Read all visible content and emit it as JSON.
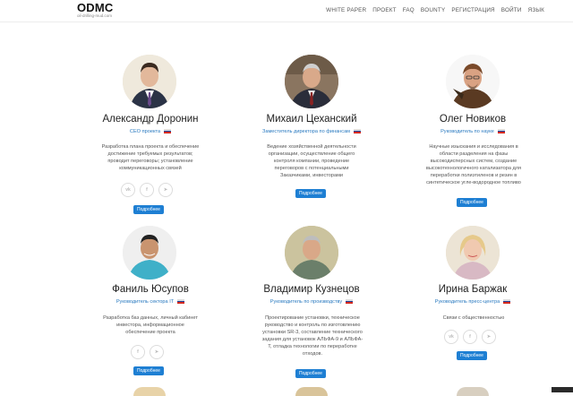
{
  "header": {
    "logo": "ODMC",
    "logo_sub": "oil-drilling-mud.com",
    "nav": [
      "WHITE PAPER",
      "ПРОЕКТ",
      "FAQ",
      "BOUNTY",
      "РЕГИСТРАЦИЯ",
      "ВОЙТИ",
      "ЯЗЫК"
    ]
  },
  "colors": {
    "accent": "#1e7fd3",
    "role": "#2a7ac0"
  },
  "team": [
    {
      "name": "Александр Доронин",
      "role": "CEO проекта",
      "desc": [
        "Разработка плана проекта и обеспечение",
        "достижение требуемых результатов;",
        "проводит переговоры; установление",
        "коммуникационных связей"
      ],
      "social": [
        "vk-icon",
        "facebook-icon",
        "telegram-icon"
      ],
      "more": "Подробнее"
    },
    {
      "name": "Михаил Цеханский",
      "role": "Заместитель директора по финансам",
      "desc": [
        "Ведение хозяйственной деятельности",
        "организации, осуществление общего",
        "контроля компании, проведение",
        "переговоров с потенциальными",
        "Заказчиками, инвесторами"
      ],
      "social": [],
      "more": "Подробнее"
    },
    {
      "name": "Олег Новиков",
      "role": "Руководитель по науке",
      "desc": [
        "Научные изыскания и исследования в",
        "области разделения на фазы",
        "высокодисперсных систем, создание",
        "высокотехнологичного катализатора для",
        "переработки полиэтиленов и резин в",
        "синтетическое угле-водородное топливо"
      ],
      "social": [],
      "more": "Подробнее"
    },
    {
      "name": "Фаниль Юсупов",
      "role": "Руководитель сектора IT",
      "desc": [
        "Разработка баз данных, личный кабинет",
        "инвестора, информационное",
        "обеспечение проекта"
      ],
      "social": [
        "facebook-icon",
        "telegram-icon"
      ],
      "more": "Подробнее"
    },
    {
      "name": "Владимир Кузнецов",
      "role": "Руководитель по производству",
      "desc": [
        "Проектирование установки, техническое",
        "руководство и контроль по изготовлению",
        "установки SR-3, составление технического",
        "задания для установок АЛЬФА-9 и АЛЬФА-",
        "Т, отладка технологии по переработке",
        "отходов."
      ],
      "social": [],
      "more": "Подробнее"
    },
    {
      "name": "Ирина Баржак",
      "role": "Руководитель пресс-центра",
      "desc": [
        "Связи с общественностью"
      ],
      "social": [
        "vk-icon",
        "facebook-icon",
        "telegram-icon"
      ],
      "more": "Подробнее"
    }
  ]
}
